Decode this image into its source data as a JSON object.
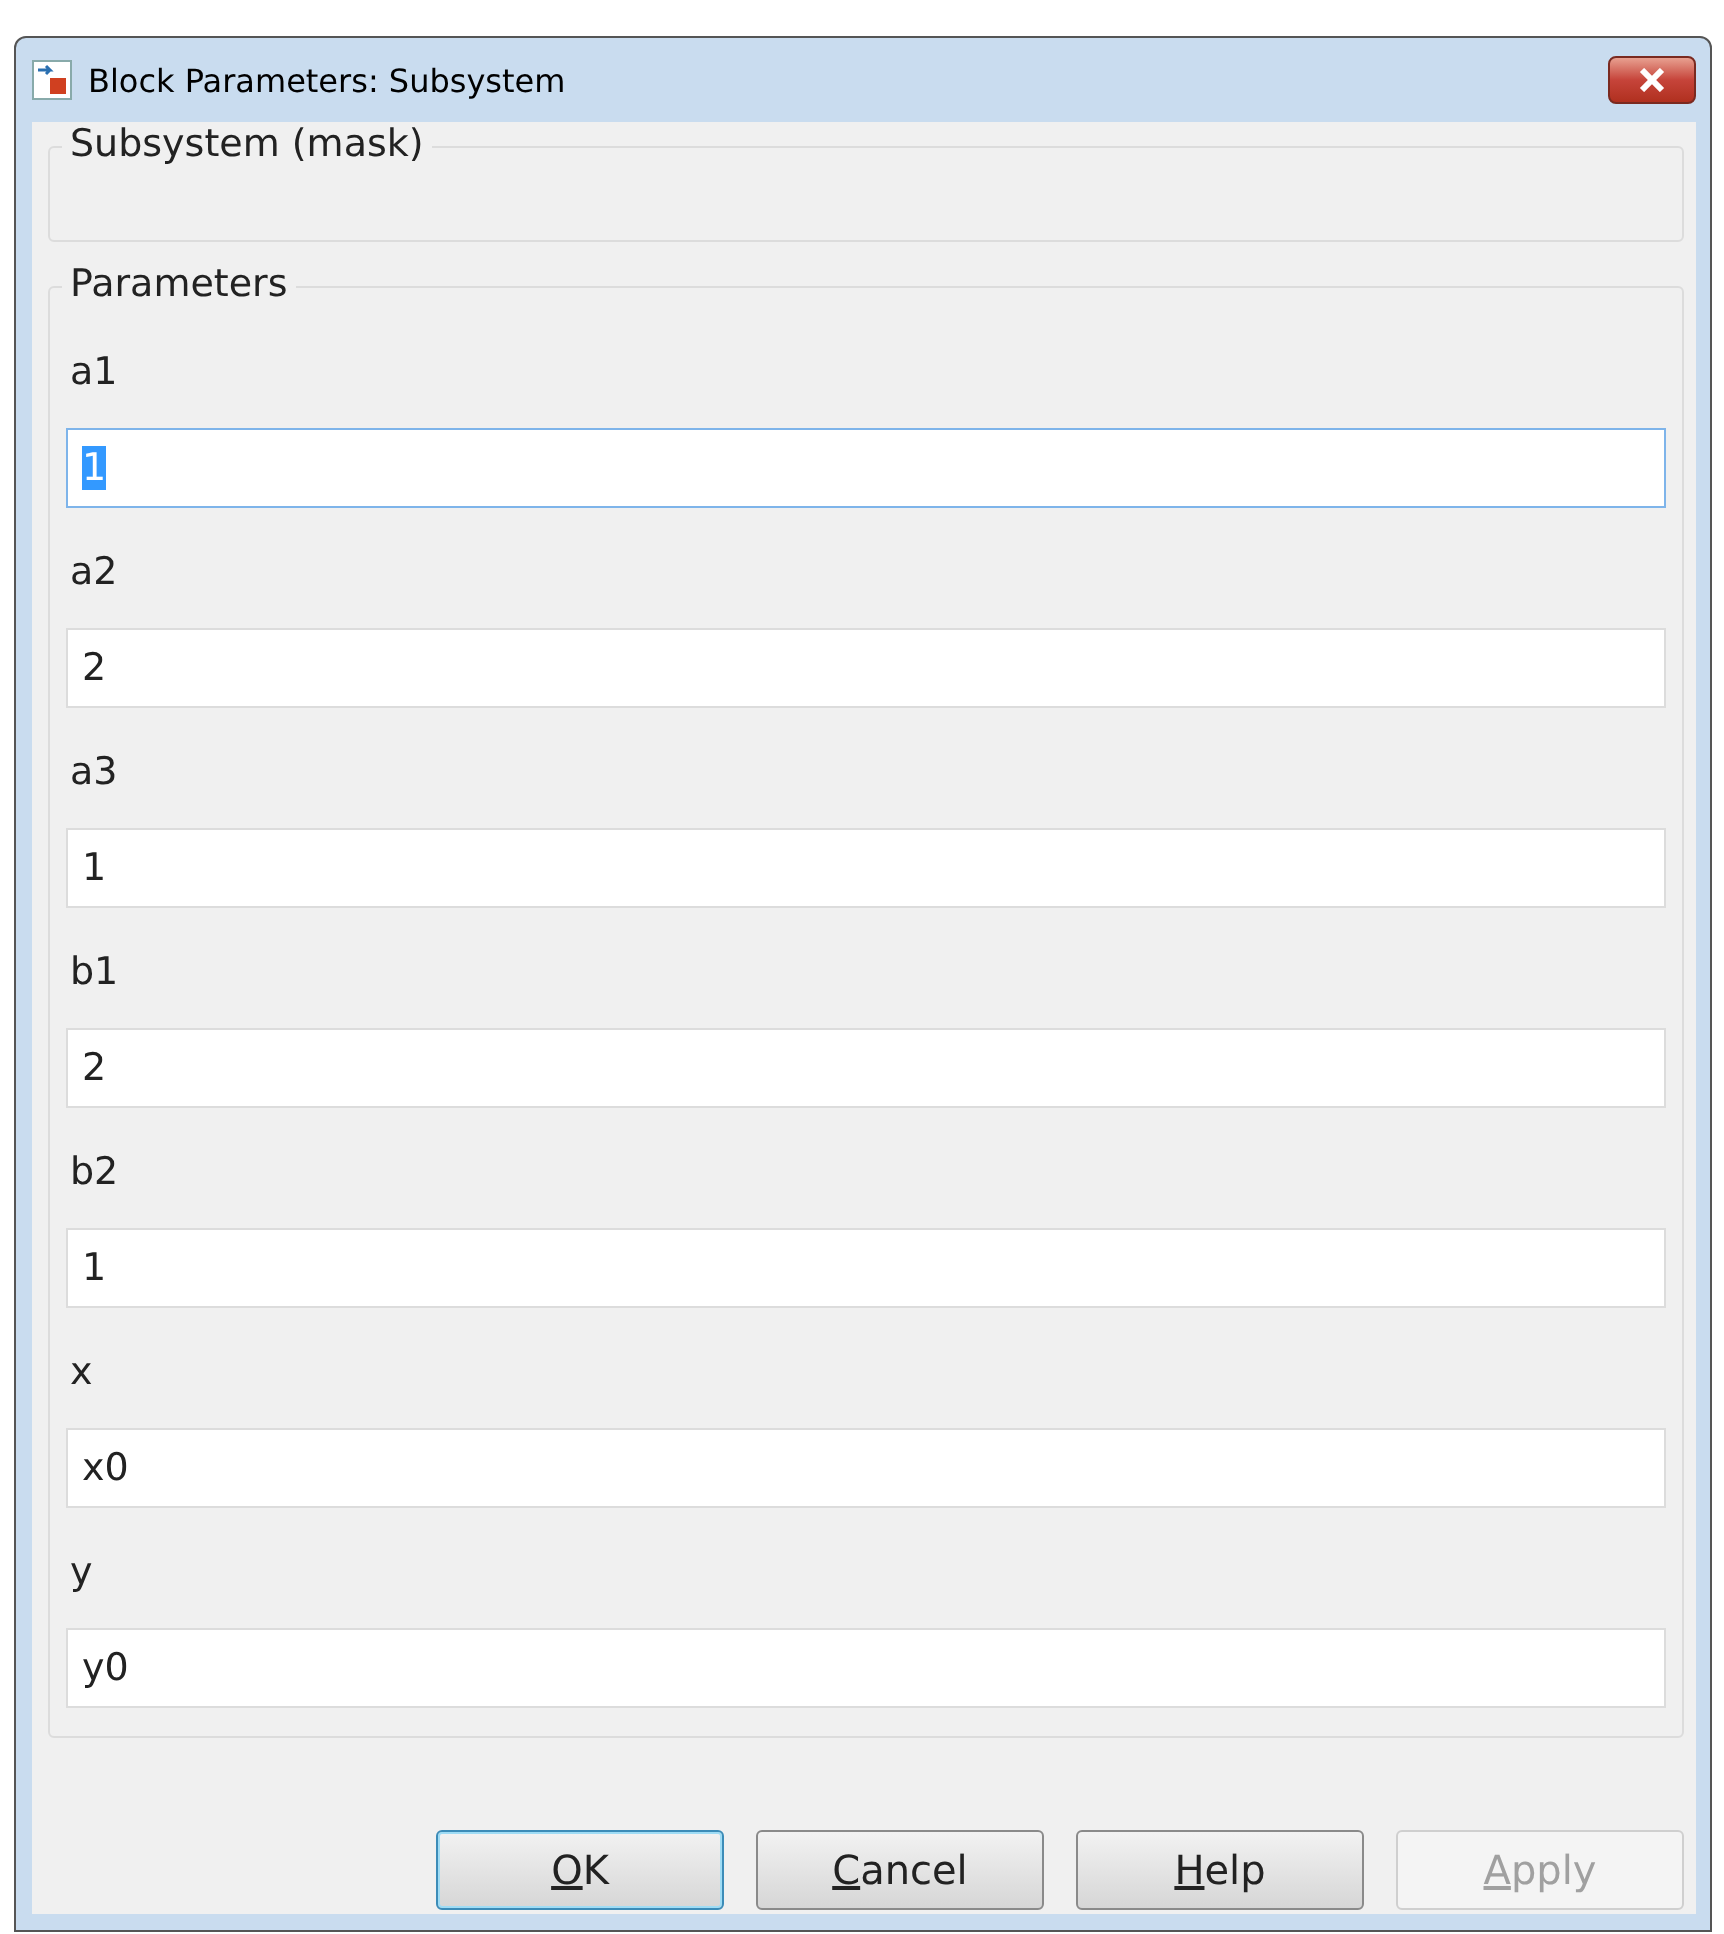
{
  "window": {
    "title": "Block Parameters: Subsystem"
  },
  "description_group": {
    "title": "Subsystem (mask)"
  },
  "parameters_group": {
    "title": "Parameters"
  },
  "parameters": [
    {
      "label": "a1",
      "value": "1",
      "focused": true,
      "text_selected": true
    },
    {
      "label": "a2",
      "value": "2",
      "focused": false,
      "text_selected": false
    },
    {
      "label": "a3",
      "value": "1",
      "focused": false,
      "text_selected": false
    },
    {
      "label": "b1",
      "value": "2",
      "focused": false,
      "text_selected": false
    },
    {
      "label": "b2",
      "value": "1",
      "focused": false,
      "text_selected": false
    },
    {
      "label": "x",
      "value": "x0",
      "focused": false,
      "text_selected": false
    },
    {
      "label": "y",
      "value": "y0",
      "focused": false,
      "text_selected": false
    }
  ],
  "buttons": [
    {
      "label": "OK",
      "mnemonic": true,
      "default": true,
      "disabled": false
    },
    {
      "label": "Cancel",
      "mnemonic": true,
      "default": false,
      "disabled": false
    },
    {
      "label": "Help",
      "mnemonic": true,
      "default": false,
      "disabled": false
    },
    {
      "label": "Apply",
      "mnemonic": true,
      "default": false,
      "disabled": true
    }
  ]
}
